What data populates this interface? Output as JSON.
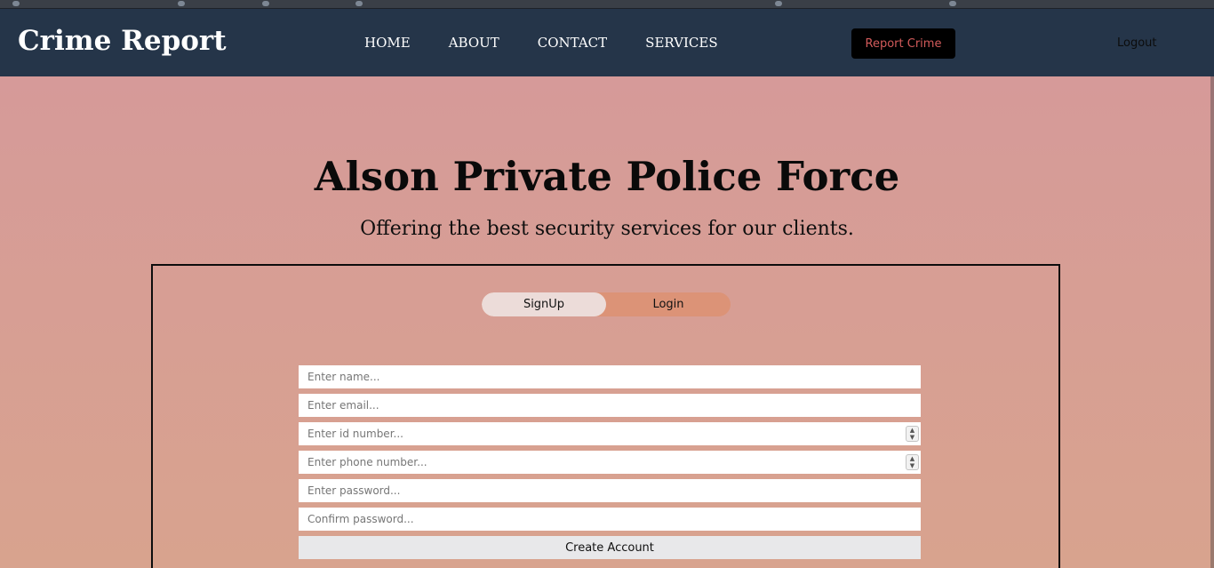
{
  "navbar": {
    "brand": "Crime Report",
    "links": [
      "HOME",
      "ABOUT",
      "CONTACT",
      "SERVICES"
    ],
    "report_label": "Report Crime",
    "logout_label": "Logout"
  },
  "hero": {
    "title": "Alson Private Police Force",
    "subtitle": "Offering the best security services for our clients."
  },
  "auth": {
    "tabs": [
      "SignUp",
      "Login"
    ],
    "active_tab": "SignUp",
    "fields": {
      "name": "Enter name...",
      "email": "Enter email...",
      "id_number": "Enter id number...",
      "phone": "Enter phone number...",
      "password": "Enter password...",
      "confirm": "Confirm password..."
    },
    "submit_label": "Create Account"
  },
  "colors": {
    "navbar": "#253549",
    "report_text": "#d35b5b",
    "toggle_bg": "#dc9377",
    "toggle_active": "#ecdcd9"
  }
}
